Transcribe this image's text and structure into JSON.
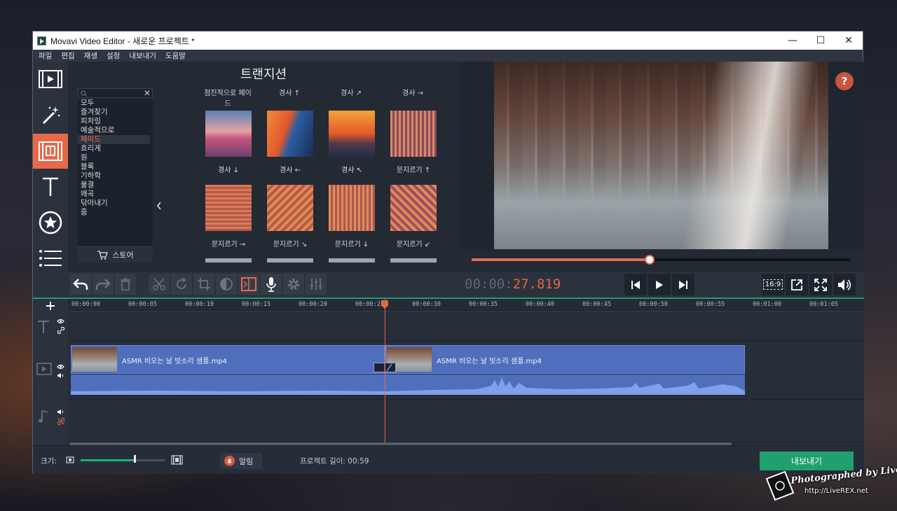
{
  "window": {
    "title": "Movavi Video Editor - 새로운 프로젝트 *",
    "minimize": "—",
    "maximize": "☐",
    "close": "✕"
  },
  "menu": [
    "파일",
    "편집",
    "재생",
    "설정",
    "내보내기",
    "도움말"
  ],
  "sidebar_icons": [
    "film-import-icon",
    "magic-wand-icon",
    "transitions-icon",
    "titles-icon",
    "stickers-icon",
    "more-icon"
  ],
  "panel": {
    "title": "트랜지션",
    "search_placeholder": "",
    "categories": [
      "모두",
      "즐겨찾기",
      "피처링",
      "예술적으로",
      "페이드",
      "흐리게",
      "원",
      "블록",
      "기하학",
      "물결",
      "왜곡",
      "닦아내기",
      "줌"
    ],
    "selected_category": "페이드",
    "store_label": "스토어",
    "top_row_labels": [
      "점진적으로 페이드",
      "경사 ↑",
      "경사 ↗",
      "경사 →"
    ],
    "tiles": [
      {
        "label": "경사 ↓"
      },
      {
        "label": "경사 ←"
      },
      {
        "label": "경사 ↖"
      },
      {
        "label": "문지르기 ↑"
      },
      {
        "label": "문지르기 →"
      },
      {
        "label": "문지르기 ↘"
      },
      {
        "label": "문지르기 ↓"
      },
      {
        "label": "문지르기 ↙"
      }
    ]
  },
  "player": {
    "timecode_prefix": "00:00:",
    "timecode_hot": "27.819",
    "aspect_label": "16:9",
    "help": "?",
    "progress": 0.47
  },
  "timeline": {
    "ticks": [
      "00:00:00",
      "00:00:05",
      "00:00:10",
      "00:00:15",
      "00:00:20",
      "00:00:25",
      "00:00:30",
      "00:00:35",
      "00:00:40",
      "00:00:45",
      "00:00:50",
      "00:00:55",
      "00:01:00",
      "00:01:05"
    ],
    "clips": [
      {
        "name": "ASMR 비오는 날 빗소리 샘플.mp4"
      },
      {
        "name": "ASMR 비오는 날 빗소리 샘플.mp4"
      }
    ]
  },
  "status": {
    "size_label": "크기:",
    "zoom": 0.63,
    "notification_label": "알림",
    "project_length": "프로젝트 길이:  00:59",
    "export_label": "내보내기"
  },
  "watermark": {
    "line1": "Photographed by LiveREX",
    "line2": "http://LiveREX.net"
  }
}
